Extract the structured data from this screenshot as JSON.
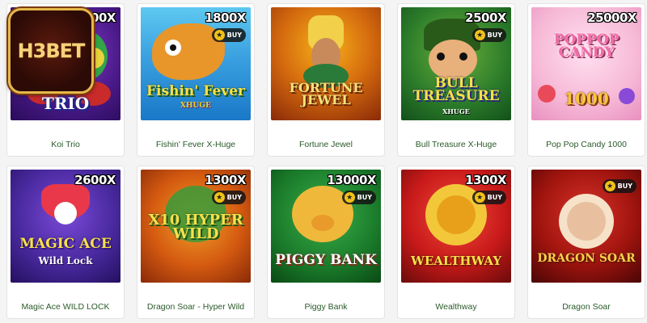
{
  "brand": {
    "logo_text": "H3BET"
  },
  "colors": {
    "caption": "#2a5a2a",
    "buy_star": "#f2c21a"
  },
  "buy_label": "BUY",
  "games": [
    {
      "name": "Koi Trio",
      "multiplier": "1800X",
      "has_buy": false,
      "art_title": "TRIO"
    },
    {
      "name": "Fishin' Fever X-Huge",
      "multiplier": "1800X",
      "has_buy": true,
      "art_title": "Fishin' Fever",
      "art_sub": "XHUGE"
    },
    {
      "name": "Fortune Jewel",
      "multiplier": "",
      "has_buy": false,
      "art_title": "FORTUNE JEWEL"
    },
    {
      "name": "Bull Treasure X-Huge",
      "multiplier": "2500X",
      "has_buy": true,
      "art_title": "BULL TREASURE",
      "art_sub": "XHUGE"
    },
    {
      "name": "Pop Pop Candy 1000",
      "multiplier": "25000X",
      "has_buy": false,
      "art_title": "POPPOP CANDY",
      "art_sub": "1000"
    },
    {
      "name": "Magic Ace WILD LOCK",
      "multiplier": "2600X",
      "has_buy": false,
      "art_title": "MAGIC ACE",
      "art_sub": "Wild Lock"
    },
    {
      "name": "Dragon Soar - Hyper Wild",
      "multiplier": "1300X",
      "has_buy": true,
      "art_title": "X10 HYPER WILD"
    },
    {
      "name": "Piggy Bank",
      "multiplier": "13000X",
      "has_buy": true,
      "art_title": "PIGGY BANK"
    },
    {
      "name": "Wealthway",
      "multiplier": "1300X",
      "has_buy": true,
      "art_title": "WEALTHWAY"
    },
    {
      "name": "Dragon Soar",
      "multiplier": "",
      "has_buy": true,
      "art_title": "DRAGON SOAR"
    }
  ]
}
